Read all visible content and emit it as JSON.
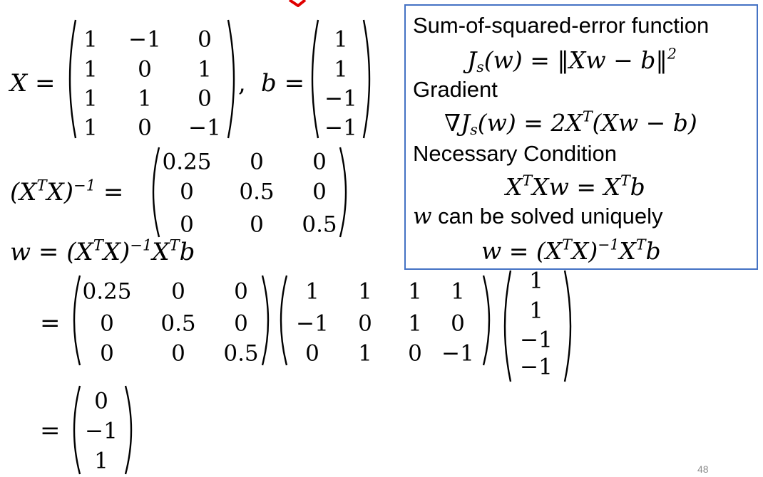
{
  "slide_number": "48",
  "accent_color": "#4472c4",
  "mark_color": "#e00000",
  "equations": {
    "X_def": {
      "lhs": "X =",
      "sep": ", ",
      "b_lhs": "b ="
    },
    "inv_lhs": "(X<sup>T</sup>X)<sup>−1</sup> =",
    "w_eq": "w = (X<sup>T</sup>X)<sup>−1</sup>X<sup>T</sup>b",
    "eq1": "=",
    "eq2": "="
  },
  "matrices": {
    "X": [
      [
        "1",
        "−1",
        "0"
      ],
      [
        "1",
        "0",
        "1"
      ],
      [
        "1",
        "1",
        "0"
      ],
      [
        "1",
        "0",
        "−1"
      ]
    ],
    "b": [
      [
        "1"
      ],
      [
        "1"
      ],
      [
        "−1"
      ],
      [
        "−1"
      ]
    ],
    "XtX_inv": [
      [
        "0.25",
        "0",
        "0"
      ],
      [
        "0",
        "0.5",
        "0"
      ],
      [
        "0",
        "0",
        "0.5"
      ]
    ],
    "XtX_inv_step": [
      [
        "0.25",
        "0",
        "0"
      ],
      [
        "0",
        "0.5",
        "0"
      ],
      [
        "0",
        "0",
        "0.5"
      ]
    ],
    "Xt": [
      [
        "1",
        "1",
        "1",
        "1"
      ],
      [
        "−1",
        "0",
        "1",
        "0"
      ],
      [
        "0",
        "1",
        "0",
        "−1"
      ]
    ],
    "b_step": [
      [
        "1"
      ],
      [
        "1"
      ],
      [
        "−1"
      ],
      [
        "−1"
      ]
    ],
    "w_result": [
      [
        "0"
      ],
      [
        "−1"
      ],
      [
        "1"
      ]
    ]
  },
  "summary_box": {
    "sse_heading": "Sum-of-squared-error function",
    "sse_formula": "J<sub>s</sub>(w) = ‖Xw − b‖<sup>2</sup>",
    "gradient_heading": "Gradient",
    "gradient_formula": "∇J<sub>s</sub>(w) = 2X<sup>T</sup>(Xw − b)",
    "necessary_heading": "Necessary Condition",
    "necessary_formula": "X<sup>T</sup>Xw = X<sup>T</sup>b",
    "solved_var": "w",
    "solved_heading": " can be solved uniquely",
    "solution_formula": "w = (X<sup>T</sup>X)<sup>−1</sup>X<sup>T</sup>b"
  }
}
